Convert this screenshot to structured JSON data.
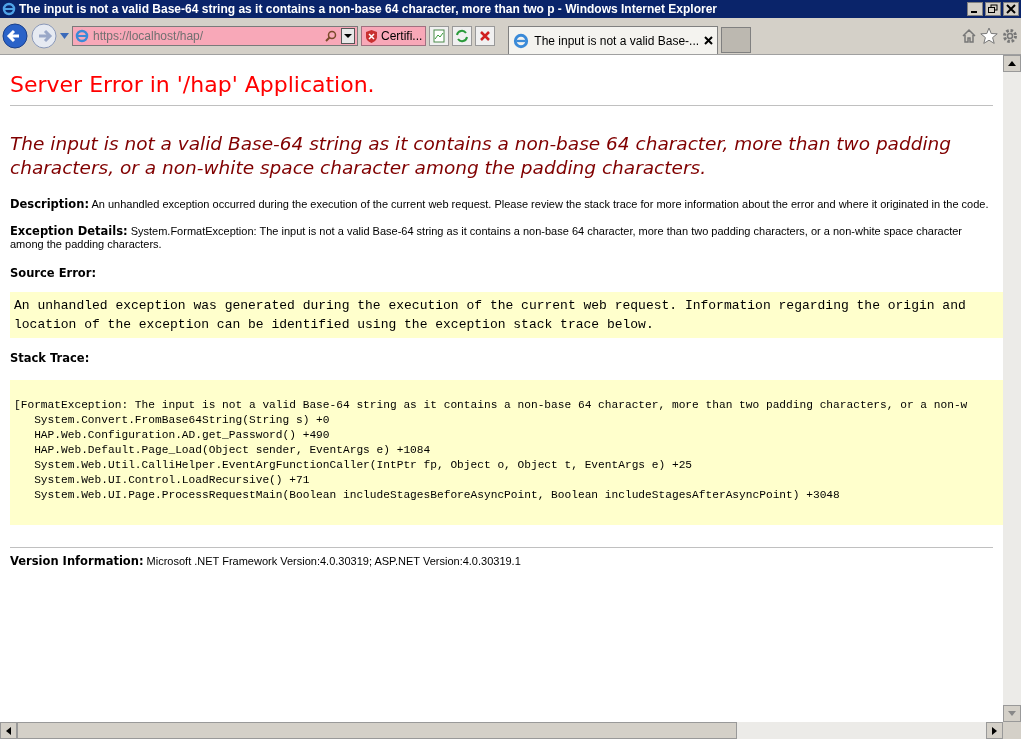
{
  "window": {
    "title": "The input is not a valid Base-64 string as it contains a non-base 64 character, more than two p - Windows Internet Explorer"
  },
  "address_bar": {
    "value": "https://localhost/hap/",
    "certificate": "Certifi..."
  },
  "tabs": [
    {
      "label": "The input is not a valid Base-...",
      "selected": true
    }
  ],
  "page": {
    "heading": "Server Error in '/hap' Application.",
    "message": "The input is not a valid Base-64 string as it contains a non-base 64 character, more than two padding characters, or a non-white space character among the padding characters.",
    "description_label": "Description:",
    "description": "An unhandled exception occurred during the execution of the current web request. Please review the stack trace for more information about the error and where it originated in the code.",
    "exception_label": "Exception Details:",
    "exception": "System.FormatException: The input is not a valid Base-64 string as it contains a non-base 64 character, more than two padding characters, or a non-white space character among the padding characters.",
    "source_error_label": "Source Error:",
    "source_error": [
      "An unhandled exception was generated during the execution of the current web request. Information regarding the origin and",
      "location of the exception can be identified using the exception stack trace below."
    ],
    "stack_trace_label": "Stack Trace:",
    "stack_trace": [
      "[FormatException: The input is not a valid Base-64 string as it contains a non-base 64 character, more than two padding characters, or a non-w",
      "   System.Convert.FromBase64String(String s) +0",
      "   HAP.Web.Configuration.AD.get_Password() +490",
      "   HAP.Web.Default.Page_Load(Object sender, EventArgs e) +1084",
      "   System.Web.Util.CalliHelper.EventArgFunctionCaller(IntPtr fp, Object o, Object t, EventArgs e) +25",
      "   System.Web.UI.Control.LoadRecursive() +71",
      "   System.Web.UI.Page.ProcessRequestMain(Boolean includeStagesBeforeAsyncPoint, Boolean includeStagesAfterAsyncPoint) +3048"
    ],
    "version_label": "Version Information:",
    "version": "Microsoft .NET Framework Version:4.0.30319; ASP.NET Version:4.0.30319.1"
  }
}
